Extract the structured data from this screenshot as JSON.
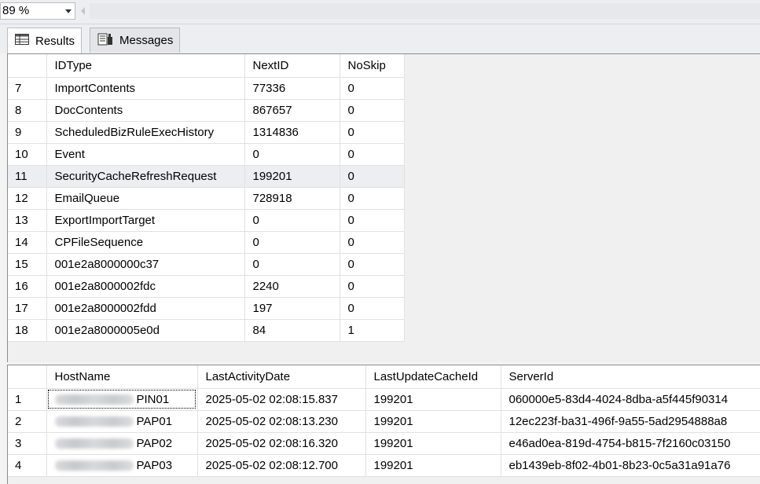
{
  "toolbar": {
    "zoom": "89 %"
  },
  "tabs": [
    {
      "label": "Results",
      "icon": "grid-icon",
      "active": true
    },
    {
      "label": "Messages",
      "icon": "messages-icon",
      "active": false
    }
  ],
  "grid1": {
    "columns": [
      "",
      "IDType",
      "NextID",
      "NoSkip"
    ],
    "rows": [
      [
        "7",
        "ImportContents",
        "77336",
        "0"
      ],
      [
        "8",
        "DocContents",
        "867657",
        "0"
      ],
      [
        "9",
        "ScheduledBizRuleExecHistory",
        "1314836",
        "0"
      ],
      [
        "10",
        "Event",
        "0",
        "0"
      ],
      [
        "11",
        "SecurityCacheRefreshRequest",
        "199201",
        "0"
      ],
      [
        "12",
        "EmailQueue",
        "728918",
        "0"
      ],
      [
        "13",
        "ExportImportTarget",
        "0",
        "0"
      ],
      [
        "14",
        "CPFileSequence",
        "0",
        "0"
      ],
      [
        "15",
        "001e2a8000000c37",
        "0",
        "0"
      ],
      [
        "16",
        "001e2a8000002fdc",
        "2240",
        "0"
      ],
      [
        "17",
        "001e2a8000002fdd",
        "197",
        "0"
      ],
      [
        "18",
        "001e2a8000005e0d",
        "84",
        "1"
      ]
    ],
    "selected_row_index": 4
  },
  "grid2": {
    "columns": [
      "",
      "HostName",
      "LastActivityDate",
      "LastUpdateCacheId",
      "ServerId"
    ],
    "rows": [
      [
        "1",
        "PIN01",
        "2025-05-02 02:08:15.837",
        "199201",
        "060000e5-83d4-4024-8dba-a5f445f90314"
      ],
      [
        "2",
        "PAP01",
        "2025-05-02 02:08:13.230",
        "199201",
        "12ec223f-ba31-496f-9a55-5ad2954888a8"
      ],
      [
        "3",
        "PAP02",
        "2025-05-02 02:08:16.320",
        "199201",
        "e46ad0ea-819d-4754-b815-7f2160c03150"
      ],
      [
        "4",
        "PAP03",
        "2025-05-02 02:08:12.700",
        "199201",
        "eb1439eb-8f02-4b01-8b23-0c5a31a91a76"
      ]
    ],
    "focused_row_index": 0
  }
}
